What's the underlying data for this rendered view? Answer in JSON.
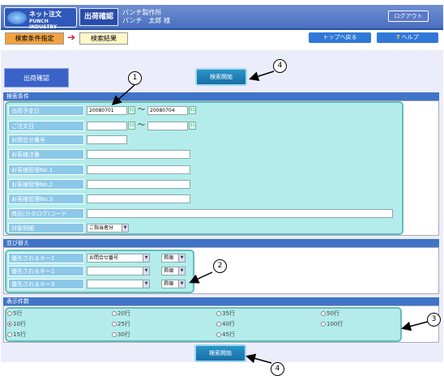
{
  "header": {
    "logo_line1": "ネット注文",
    "logo_line2": "PUNCH INDUSTRY",
    "page_title": "出荷確認",
    "company": "パンチ製作所",
    "user": "パンチ　太郎 様",
    "logout_label": "ログアウト"
  },
  "steps": {
    "step1": "検索条件指定",
    "arrow": "➔",
    "step2": "検索結果"
  },
  "nav": {
    "top_label": "トップへ戻る",
    "help_mark": "?",
    "help_label": "ヘルプ"
  },
  "ship_badge": "出荷確認",
  "search_button": "検索開始",
  "sections": {
    "conditions": "検索条件",
    "sort": "並び替え",
    "count": "表示件数"
  },
  "conditions": {
    "ship_date_label": "出荷予定日",
    "ship_date_from": "20080701",
    "tilde": "～",
    "ship_date_to": "20080704",
    "order_date_label": "ご注文日",
    "inquiry_label": "お問合せ番号",
    "cust_no_label": "お客様注番",
    "cust_mgmt1_label": "お客様管理No.1",
    "cust_mgmt2_label": "お客様管理No.2",
    "cust_mgmt3_label": "お客様管理No.3",
    "product_code_label": "商品(カタログ)コード",
    "target_label": "対象明細",
    "target_value": "ご指当者分",
    "cal_glyph": "31"
  },
  "sort": {
    "key1_label": "優先されるキー1",
    "key1_value": "お問合せ番号",
    "key1_order": "昇順",
    "key2_label": "優先されるキー2",
    "key2_order": "昇順",
    "key3_label": "優先されるキー3",
    "key3_order": "昇順",
    "dropdown_glyph": "▼"
  },
  "count_options": [
    "5行",
    "10行",
    "15行",
    "20行",
    "25行",
    "30行",
    "35行",
    "40行",
    "45行",
    "50行",
    "100行"
  ],
  "count_selected": "10行",
  "callouts": {
    "c1": "1",
    "c2": "2",
    "c3": "3",
    "c4a": "4",
    "c4b": "4"
  }
}
